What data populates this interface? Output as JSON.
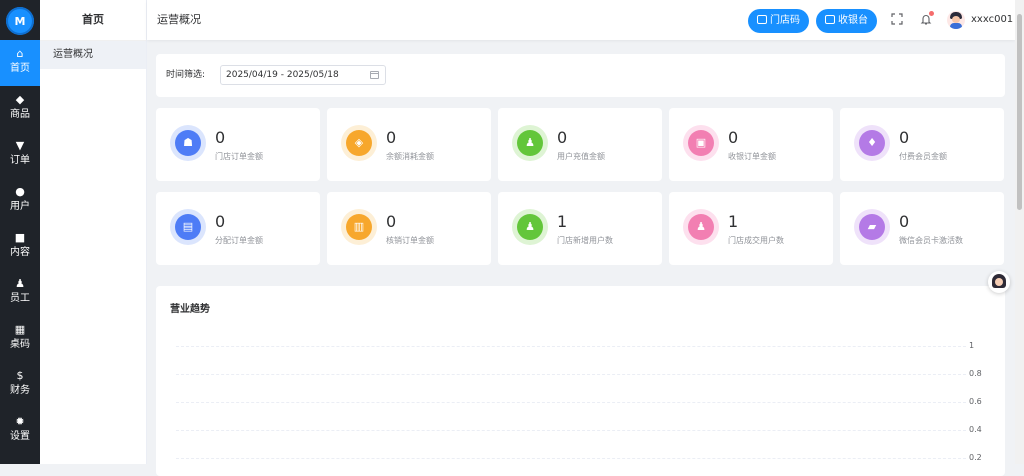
{
  "rail": {
    "items": [
      {
        "label": "首页",
        "icon": "⌂",
        "active": true
      },
      {
        "label": "商品",
        "icon": "◆",
        "active": false
      },
      {
        "label": "订单",
        "icon": "▼",
        "active": false
      },
      {
        "label": "用户",
        "icon": "●",
        "active": false
      },
      {
        "label": "内容",
        "icon": "■",
        "active": false
      },
      {
        "label": "员工",
        "icon": "♟",
        "active": false
      },
      {
        "label": "桌码",
        "icon": "▦",
        "active": false
      },
      {
        "label": "财务",
        "icon": "$",
        "active": false
      },
      {
        "label": "设置",
        "icon": "✹",
        "active": false
      }
    ]
  },
  "submenu": {
    "title": "首页",
    "items": [
      "运营概况"
    ]
  },
  "header": {
    "breadcrumb": "运营概况",
    "store_code_button": "门店码",
    "cashier_button": "收银台",
    "username": "xxxc001"
  },
  "filter": {
    "label": "时间筛选:",
    "date_range": "2025/04/19 - 2025/05/18"
  },
  "stats": [
    {
      "value": "0",
      "label": "门店订单金额",
      "color": "#4e7cf6",
      "ring": "#dbe5fd",
      "icon": "☗"
    },
    {
      "value": "0",
      "label": "余额消耗金额",
      "color": "#f7a72c",
      "ring": "#fdefd6",
      "icon": "◈"
    },
    {
      "value": "0",
      "label": "用户充值金额",
      "color": "#63c63a",
      "ring": "#def4d4",
      "icon": "♟"
    },
    {
      "value": "0",
      "label": "收银订单金额",
      "color": "#f27fb2",
      "ring": "#fde0ee",
      "icon": "▣"
    },
    {
      "value": "0",
      "label": "付费会员金额",
      "color": "#b47ae6",
      "ring": "#efe2fa",
      "icon": "♦"
    },
    {
      "value": "0",
      "label": "分配订单金额",
      "color": "#4e7cf6",
      "ring": "#dbe5fd",
      "icon": "▤"
    },
    {
      "value": "0",
      "label": "核销订单金额",
      "color": "#f7a72c",
      "ring": "#fdefd6",
      "icon": "▥"
    },
    {
      "value": "1",
      "label": "门店新增用户数",
      "color": "#63c63a",
      "ring": "#def4d4",
      "icon": "♟"
    },
    {
      "value": "1",
      "label": "门店成交用户数",
      "color": "#f27fb2",
      "ring": "#fde0ee",
      "icon": "♟"
    },
    {
      "value": "0",
      "label": "微信会员卡激活数",
      "color": "#b47ae6",
      "ring": "#efe2fa",
      "icon": "▰"
    }
  ],
  "trend": {
    "title": "营业趋势",
    "yticks": [
      "1",
      "0.8",
      "0.6",
      "0.4",
      "0.2"
    ]
  }
}
